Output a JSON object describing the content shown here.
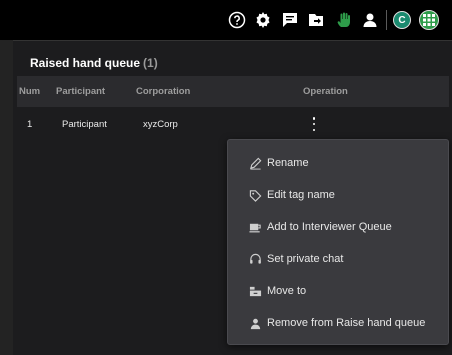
{
  "topbar": {
    "icons": [
      "help-icon",
      "gear-icon",
      "chat-icon",
      "share-icon",
      "raise-hand-icon",
      "person-icon",
      "apps-grid-icon"
    ],
    "avatar_initial": "C",
    "raise_hand_color": "#2e9c4a",
    "avatar_color": "#1a8a6f"
  },
  "panel": {
    "title": "Raised hand queue",
    "count": "(1)",
    "columns": {
      "num": "Num",
      "participant": "Participant",
      "corporation": "Corporation",
      "operation": "Operation"
    },
    "rows": [
      {
        "num": "1",
        "participant": "Participant",
        "corporation": "xyzCorp"
      }
    ]
  },
  "menu": {
    "items": [
      {
        "label": "Rename",
        "icon": "pencil-icon"
      },
      {
        "label": "Edit tag name",
        "icon": "tag-icon"
      },
      {
        "label": "Add to Interviewer Queue",
        "icon": "cup-icon"
      },
      {
        "label": "Set private chat",
        "icon": "headset-icon"
      },
      {
        "label": "Move to",
        "icon": "move-icon"
      },
      {
        "label": "Remove from Raise hand queue",
        "icon": "person-icon"
      }
    ]
  }
}
